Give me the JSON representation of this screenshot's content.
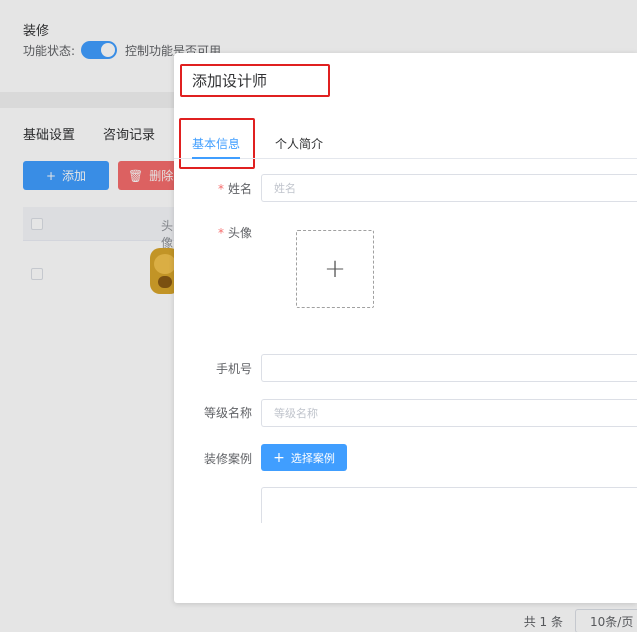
{
  "background": {
    "section_title": "装修",
    "status_label": "功能状态:",
    "status_desc": "控制功能是否可用",
    "tabs": [
      "基础设置",
      "咨询记录"
    ],
    "add_button": "添加",
    "delete_button": "删除",
    "table_header_avatar": "头像",
    "pager_total": "共 1 条",
    "pager_size": "10条/页",
    "colors": {
      "primary": "#409eff",
      "danger": "#f56c6c"
    }
  },
  "dialog": {
    "title": "添加设计师",
    "tabs": {
      "basic": "基本信息",
      "intro": "个人简介"
    },
    "form": {
      "name_label": "姓名",
      "name_placeholder": "姓名",
      "avatar_label": "头像",
      "upload_icon": "+",
      "phone_label": "手机号",
      "phone_value": "",
      "level_label": "等级名称",
      "level_placeholder": "等级名称",
      "cases_label": "装修案例",
      "cases_button": "选择案例",
      "required_mark": "*"
    },
    "colors": {
      "accent": "#409eff",
      "highlight_box": "#e02020",
      "required": "#f56c6c"
    }
  }
}
